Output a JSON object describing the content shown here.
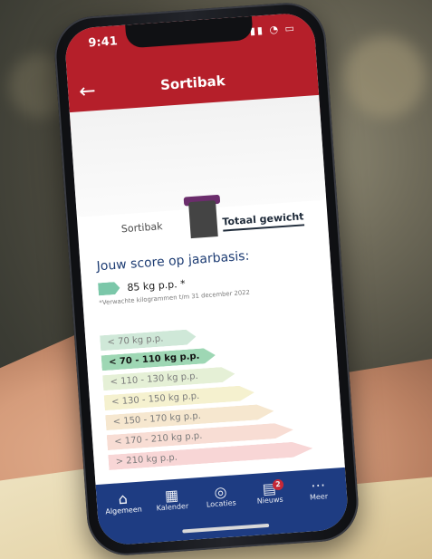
{
  "status_bar": {
    "time": "9:41"
  },
  "header": {
    "title": "Sortibak",
    "back_icon": "back-arrow-icon"
  },
  "tabs": [
    {
      "label": "Sortibak",
      "active": false
    },
    {
      "label": "Totaal gewicht",
      "active": true
    }
  ],
  "score": {
    "heading": "Jouw score op jaarbasis:",
    "value": "85 kg p.p. *",
    "note": "*Verwachte kilogrammen t/m 31 december 2022",
    "arrow_color": "#7bc7a9"
  },
  "scale": [
    {
      "label": "< 70 kg p.p.",
      "color": "#cfe8d8",
      "active": false
    },
    {
      "label": "< 70 - 110 kg p.p.",
      "color": "#9ed7b4",
      "active": true
    },
    {
      "label": "< 110 - 130 kg p.p.",
      "color": "#e5f0d6",
      "active": false
    },
    {
      "label": "< 130 - 150 kg p.p.",
      "color": "#f5f1cf",
      "active": false
    },
    {
      "label": "< 150 - 170 kg p.p.",
      "color": "#f6e7cf",
      "active": false
    },
    {
      "label": "< 170 - 210 kg p.p.",
      "color": "#f8ddd4",
      "active": false
    },
    {
      "label": "> 210 kg p.p.",
      "color": "#f8d6d6",
      "active": false
    }
  ],
  "bottom_nav": [
    {
      "label": "Algemeen",
      "icon": "home-icon",
      "glyph": "⌂",
      "active": true
    },
    {
      "label": "Kalender",
      "icon": "calendar-icon",
      "glyph": "▦",
      "active": false
    },
    {
      "label": "Locaties",
      "icon": "location-icon",
      "glyph": "◎",
      "active": false
    },
    {
      "label": "Nieuws",
      "icon": "news-icon",
      "glyph": "▤",
      "active": false,
      "badge": "2"
    },
    {
      "label": "Meer",
      "icon": "more-icon",
      "glyph": "⋯",
      "active": false
    }
  ],
  "colors": {
    "header_red": "#b51f2a",
    "nav_blue": "#1e3c82",
    "heading_blue": "#1d3c73"
  }
}
